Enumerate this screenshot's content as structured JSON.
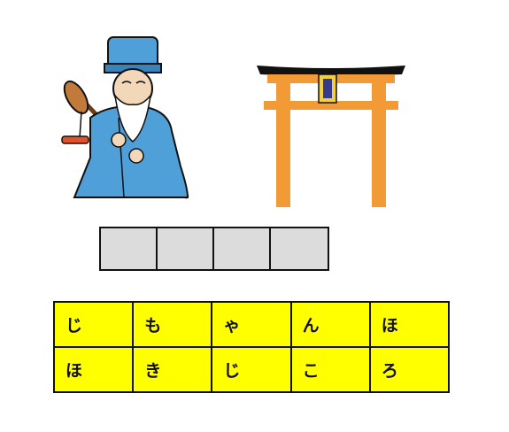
{
  "images": {
    "sage": "old-sage-with-staff-illustration",
    "torii": "torii-gate-illustration"
  },
  "answer": {
    "slots": [
      "",
      "",
      "",
      ""
    ]
  },
  "tiles": {
    "row1": [
      "じ",
      "も",
      "ゃ",
      "ん",
      "ほ"
    ],
    "row2": [
      "ほ",
      "き",
      "じ",
      "こ",
      "ろ"
    ]
  },
  "colors": {
    "tile_bg": "#ffff00",
    "slot_bg": "#dcdcdc",
    "torii": "#f29a36",
    "robe": "#4f9fd8"
  }
}
